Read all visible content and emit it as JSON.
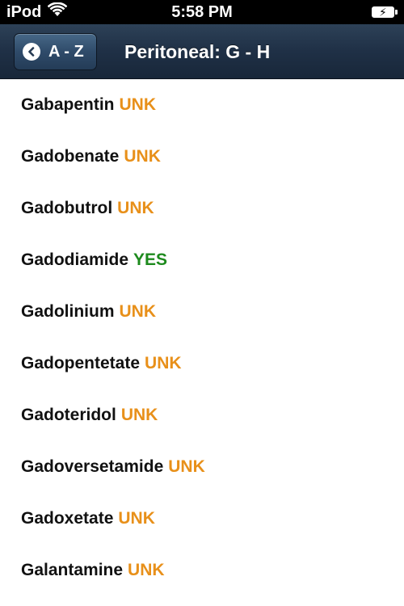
{
  "statusbar": {
    "carrier": "iPod",
    "time": "5:58 PM"
  },
  "navbar": {
    "back_label": "A - Z",
    "title": "Peritoneal: G - H"
  },
  "colors": {
    "unk": "#e8901a",
    "yes": "#1d8a1d",
    "nav": "#1f3046"
  },
  "items": [
    {
      "name": "Gabapentin",
      "status": "UNK"
    },
    {
      "name": "Gadobenate",
      "status": "UNK"
    },
    {
      "name": "Gadobutrol",
      "status": "UNK"
    },
    {
      "name": "Gadodiamide",
      "status": "YES"
    },
    {
      "name": "Gadolinium",
      "status": "UNK"
    },
    {
      "name": "Gadopentetate",
      "status": "UNK"
    },
    {
      "name": "Gadoteridol",
      "status": "UNK"
    },
    {
      "name": "Gadoversetamide",
      "status": "UNK"
    },
    {
      "name": "Gadoxetate",
      "status": "UNK"
    },
    {
      "name": "Galantamine",
      "status": "UNK"
    }
  ]
}
